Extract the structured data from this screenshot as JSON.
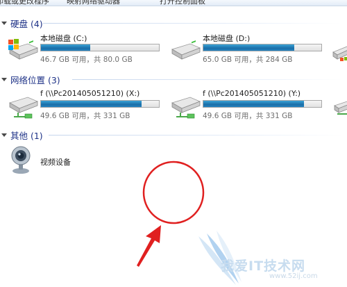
{
  "toolbar": {
    "items": [
      {
        "label": "卸载或更改程序"
      },
      {
        "label": "映射网络驱动器"
      },
      {
        "label": "打开控制面板"
      }
    ]
  },
  "groups": {
    "hard_disks": {
      "title": "硬盘 (4)",
      "drives": [
        {
          "name": "本地磁盘 (C:)",
          "space": "46.7 GB 可用，共 80.0 GB",
          "used_fraction": 0.42,
          "icon": "windows-drive-icon"
        },
        {
          "name": "本地磁盘 (D:)",
          "space": "65.0 GB 可用，共 284 GB",
          "used_fraction": 0.77,
          "icon": "hard-drive-icon"
        }
      ]
    },
    "network": {
      "title": "网络位置 (3)",
      "drives": [
        {
          "name": "f (\\\\Pc201405051210) (X:)",
          "space": "49.6 GB 可用，共 331 GB",
          "used_fraction": 0.85,
          "icon": "network-drive-icon"
        },
        {
          "name": "f (\\\\Pc201405051210) (Y:)",
          "space": "49.6 GB 可用，共 331 GB",
          "used_fraction": 0.85,
          "icon": "network-drive-icon"
        }
      ]
    },
    "other": {
      "title": "其他 (1)",
      "items": [
        {
          "name": "视频设备",
          "icon": "webcam-icon"
        }
      ]
    }
  },
  "watermark": {
    "text": "我爱IT技术网",
    "url": "www.52ij.com"
  },
  "colors": {
    "group_title": "#1e3287",
    "bar_fill": "#1f79b5",
    "annotation": "#e02020"
  }
}
